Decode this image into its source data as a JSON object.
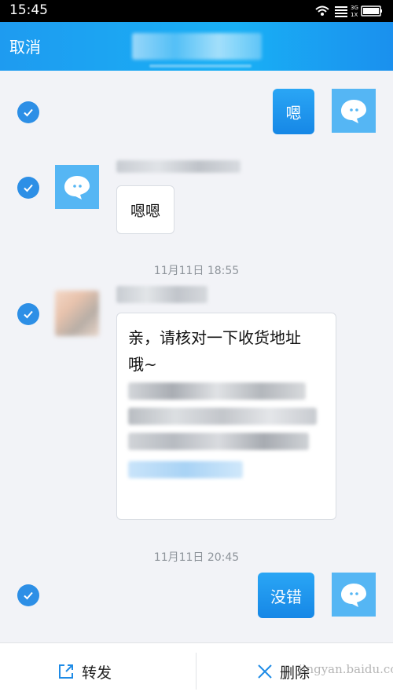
{
  "status_bar": {
    "time": "15:45",
    "network": "3G",
    "signal_label": "1X"
  },
  "header": {
    "cancel_label": "取消"
  },
  "messages": [
    {
      "type": "outgoing",
      "text": "嗯"
    },
    {
      "type": "incoming",
      "text": "嗯嗯"
    },
    {
      "type": "timestamp",
      "text": "11月11日 18:55"
    },
    {
      "type": "incoming",
      "text_line1": "亲，请核对一下收货地址",
      "text_line2": "哦~"
    },
    {
      "type": "timestamp",
      "text": "11月11日 20:45"
    },
    {
      "type": "outgoing",
      "text": "没错"
    }
  ],
  "bottom_bar": {
    "forward_label": "转发",
    "delete_label": "删除"
  },
  "watermark": "jingyan.baidu.com",
  "colors": {
    "accent": "#1e9bf0",
    "check": "#2d8fe6",
    "avatar": "#55b6f4",
    "background": "#f2f3f7"
  }
}
